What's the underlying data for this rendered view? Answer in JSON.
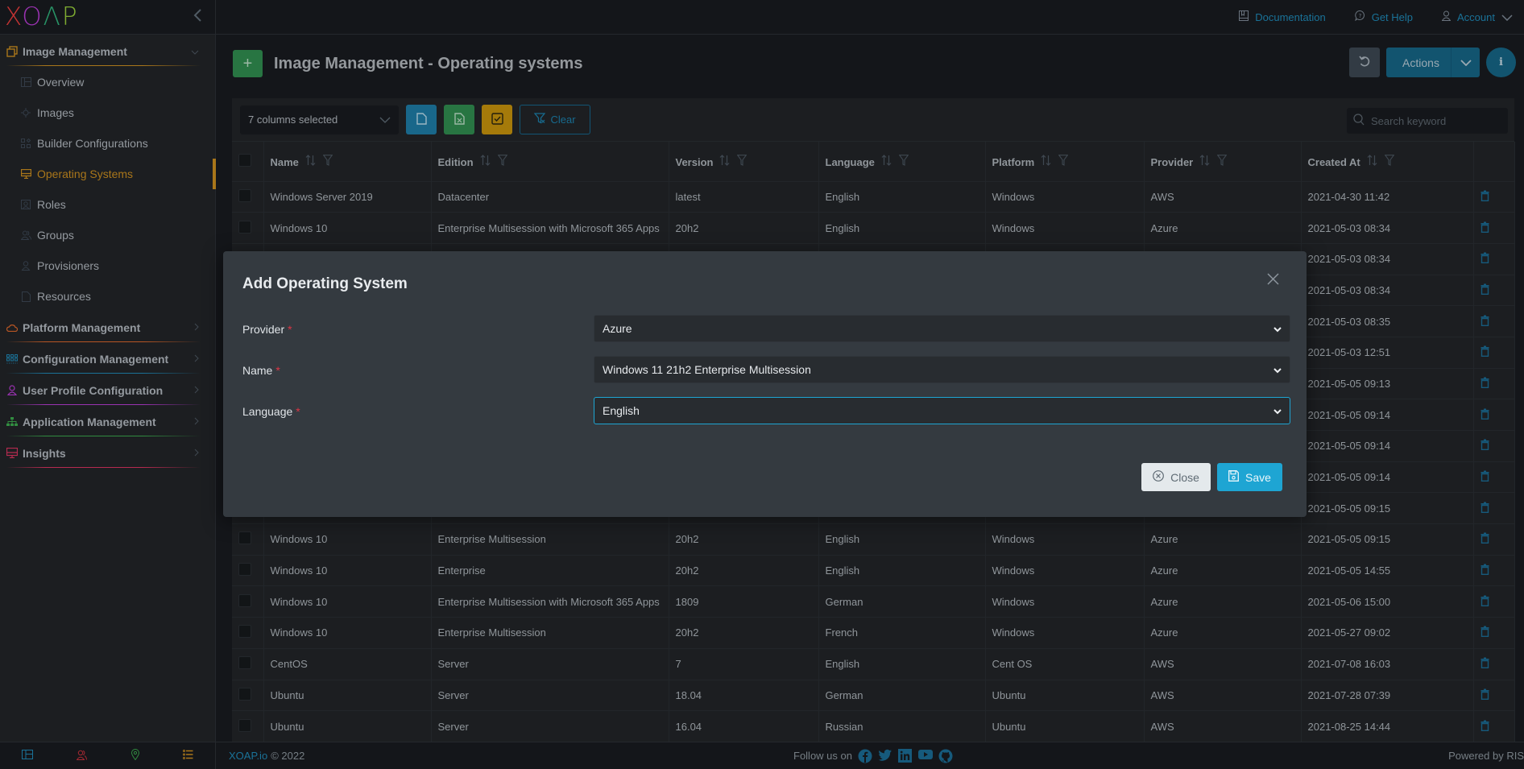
{
  "app": {
    "logo_letters": [
      "X",
      "O",
      "Λ",
      "P"
    ]
  },
  "topbar": {
    "documentation": "Documentation",
    "get_help": "Get Help",
    "account": "Account"
  },
  "sidebar": {
    "groups": [
      {
        "label": "Image Management",
        "icon": "stack-icon",
        "color": "#c78b1f",
        "expanded": true
      },
      {
        "label": "Platform Management",
        "icon": "cloud-icon",
        "color": "#d9662b"
      },
      {
        "label": "Configuration Management",
        "icon": "grid-icon",
        "color": "#1f86b3"
      },
      {
        "label": "User Profile Configuration",
        "icon": "user-icon",
        "color": "#b53bd0"
      },
      {
        "label": "Application Management",
        "icon": "sitemap-icon",
        "color": "#3aa54c"
      },
      {
        "label": "Insights",
        "icon": "monitor-icon",
        "color": "#d6335e"
      }
    ],
    "items": [
      {
        "label": "Overview",
        "icon": "layout-icon"
      },
      {
        "label": "Images",
        "icon": "crosshair-icon"
      },
      {
        "label": "Builder Configurations",
        "icon": "blocks-icon"
      },
      {
        "label": "Operating Systems",
        "icon": "monitor-icon",
        "active": true
      },
      {
        "label": "Roles",
        "icon": "portrait-icon"
      },
      {
        "label": "Groups",
        "icon": "users-icon"
      },
      {
        "label": "Provisioners",
        "icon": "user-icon"
      },
      {
        "label": "Resources",
        "icon": "file-icon"
      }
    ],
    "bottom_icons": [
      "layout-icon",
      "users-icon",
      "location-pin-icon",
      "list-icon"
    ]
  },
  "page": {
    "title": "Image Management - Operating systems",
    "actions_label": "Actions"
  },
  "toolbar": {
    "columns_selected": "7 columns selected",
    "clear_label": "Clear",
    "search_placeholder": "Search keyword"
  },
  "table": {
    "columns": [
      "Name",
      "Edition",
      "Version",
      "Language",
      "Platform",
      "Provider",
      "Created At"
    ],
    "rows": [
      [
        "Windows Server 2019",
        "Datacenter",
        "latest",
        "English",
        "Windows",
        "AWS",
        "2021-04-30 11:42"
      ],
      [
        "Windows 10",
        "Enterprise Multisession with Microsoft 365 Apps",
        "20h2",
        "English",
        "Windows",
        "Azure",
        "2021-05-03 08:34"
      ],
      [
        "",
        "",
        "",
        "",
        "",
        "",
        "2021-05-03 08:34"
      ],
      [
        "",
        "",
        "",
        "",
        "",
        "",
        "2021-05-03 08:34"
      ],
      [
        "",
        "",
        "",
        "",
        "",
        "",
        "2021-05-03 08:35"
      ],
      [
        "",
        "",
        "",
        "",
        "",
        "",
        "2021-05-03 12:51"
      ],
      [
        "",
        "",
        "",
        "",
        "",
        "",
        "2021-05-05 09:13"
      ],
      [
        "",
        "",
        "",
        "",
        "",
        "",
        "2021-05-05 09:14"
      ],
      [
        "",
        "",
        "",
        "",
        "",
        "",
        "2021-05-05 09:14"
      ],
      [
        "",
        "",
        "",
        "",
        "",
        "",
        "2021-05-05 09:14"
      ],
      [
        "",
        "",
        "",
        "",
        "",
        "",
        "2021-05-05 09:15"
      ],
      [
        "Windows 10",
        "Enterprise Multisession",
        "20h2",
        "English",
        "Windows",
        "Azure",
        "2021-05-05 09:15"
      ],
      [
        "Windows 10",
        "Enterprise",
        "20h2",
        "English",
        "Windows",
        "Azure",
        "2021-05-05 14:55"
      ],
      [
        "Windows 10",
        "Enterprise Multisession with Microsoft 365 Apps",
        "1809",
        "German",
        "Windows",
        "Azure",
        "2021-05-06 15:00"
      ],
      [
        "Windows 10",
        "Enterprise Multisession",
        "20h2",
        "French",
        "Windows",
        "Azure",
        "2021-05-27 09:02"
      ],
      [
        "CentOS",
        "Server",
        "7",
        "English",
        "Cent OS",
        "AWS",
        "2021-07-08 16:03"
      ],
      [
        "Ubuntu",
        "Server",
        "18.04",
        "German",
        "Ubuntu",
        "AWS",
        "2021-07-28 07:39"
      ],
      [
        "Ubuntu",
        "Server",
        "16.04",
        "Russian",
        "Ubuntu",
        "AWS",
        "2021-08-25 14:44"
      ]
    ]
  },
  "modal": {
    "title": "Add Operating System",
    "fields": [
      {
        "label": "Provider",
        "required": "*",
        "value": "Azure"
      },
      {
        "label": "Name",
        "required": "*",
        "value": "Windows 11 21h2 Enterprise Multisession"
      },
      {
        "label": "Language",
        "required": "*",
        "value": "English",
        "focused": true
      }
    ],
    "close_label": "Close",
    "save_label": "Save"
  },
  "footer": {
    "brand": "XOAP.io",
    "copyright": "© 2022",
    "follow": "Follow us on",
    "social": [
      "facebook-icon",
      "twitter-icon",
      "linkedin-icon",
      "youtube-icon",
      "github-icon"
    ],
    "powered": "Powered by RIS"
  },
  "colors": {
    "accent": "#1ea5d3",
    "active": "#c78b1f",
    "add": "#2f8a4e"
  }
}
